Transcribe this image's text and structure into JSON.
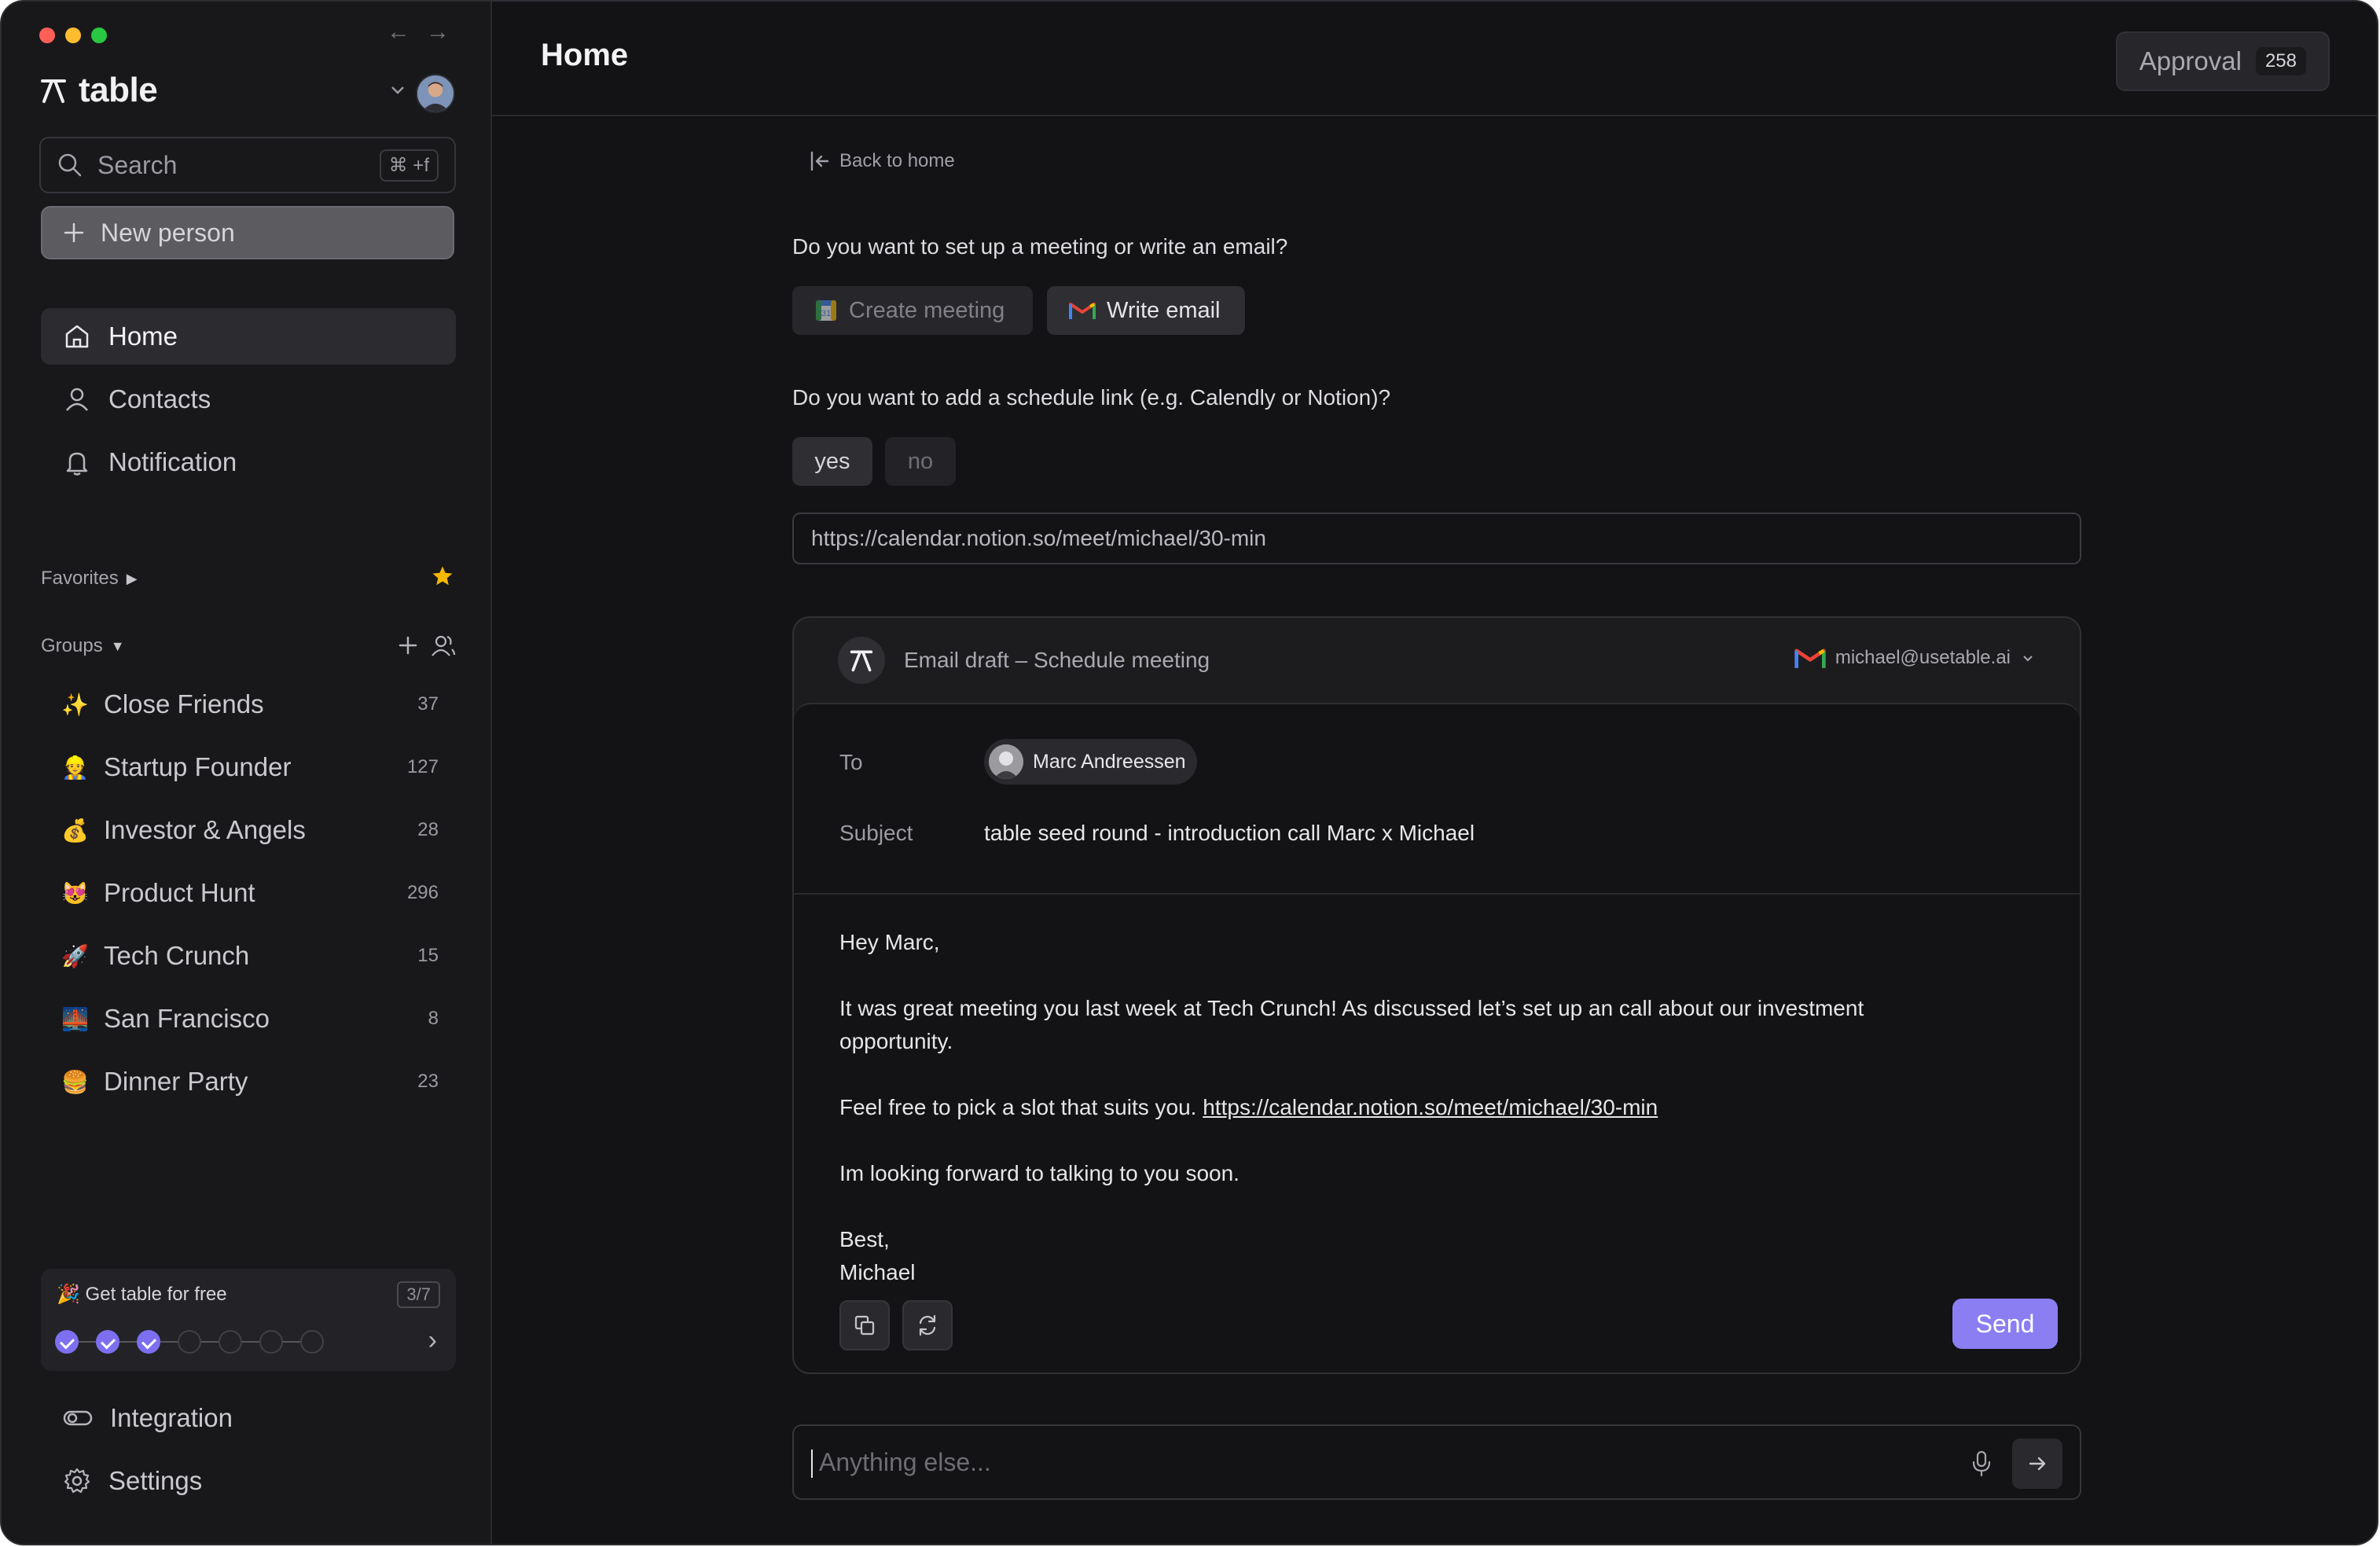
{
  "window": {
    "traffic_colors": [
      "#ff5f57",
      "#febc2e",
      "#28c840"
    ]
  },
  "sidebar": {
    "brand": "table",
    "search": {
      "placeholder": "Search",
      "shortcut": "⌘ +f"
    },
    "new_person_label": "New person",
    "nav": [
      {
        "label": "Home",
        "icon": "home-icon",
        "active": true
      },
      {
        "label": "Contacts",
        "icon": "user-icon"
      },
      {
        "label": "Notification",
        "icon": "bell-icon"
      }
    ],
    "favorites_label": "Favorites",
    "groups_label": "Groups",
    "groups": [
      {
        "emoji": "✨",
        "label": "Close Friends",
        "count": "37"
      },
      {
        "emoji": "👷",
        "label": "Startup Founder",
        "count": "127"
      },
      {
        "emoji": "💰",
        "label": "Investor & Angels",
        "count": "28"
      },
      {
        "emoji": "😻",
        "label": "Product Hunt",
        "count": "296"
      },
      {
        "emoji": "🚀",
        "label": "Tech Crunch",
        "count": "15"
      },
      {
        "emoji": "🌉",
        "label": "San Francisco",
        "count": "8"
      },
      {
        "emoji": "🍔",
        "label": "Dinner Party",
        "count": "23"
      }
    ],
    "promo": {
      "title": "🎉 Get table for free",
      "progress": "3/7",
      "completed_steps": 3,
      "total_steps": 7
    },
    "bottom_nav": [
      {
        "label": "Integration",
        "icon": "toggle-icon"
      },
      {
        "label": "Settings",
        "icon": "gear-icon"
      }
    ]
  },
  "header": {
    "title": "Home",
    "approval_label": "Approval",
    "approval_count": "258"
  },
  "main": {
    "back_label": "Back to home",
    "question1": "Do you want to set up a meeting or write an email?",
    "create_meeting_label": "Create meeting",
    "write_email_label": "Write email",
    "question2": "Do you want to add a schedule link (e.g. Calendly or Notion)?",
    "yes_label": "yes",
    "no_label": "no",
    "schedule_url": "https://calendar.notion.so/meet/michael/30-min",
    "draft": {
      "title": "Email draft – Schedule meeting",
      "sender": "michael@usetable.ai",
      "to_label": "To",
      "recipient": "Marc Andreessen",
      "subject_label": "Subject",
      "subject": "table seed round - introduction call Marc x Michael",
      "greeting": "Hey Marc,",
      "paragraph1": "It was great meeting you last week at Tech Crunch! As discussed let’s set up an call about our investment opportunity.",
      "paragraph2_prefix": "Feel free to pick a slot that suits you.",
      "paragraph2_link": "https://calendar.notion.so/meet/michael/30-min",
      "paragraph3": "Im looking forward to talking to you soon.",
      "signoff": "Best,",
      "signature": "Michael",
      "send_label": "Send"
    },
    "ask_placeholder": "Anything else..."
  },
  "colors": {
    "accent": "#8b7ef2",
    "step_done": "#7c6ff0",
    "star": "#f5b700"
  }
}
